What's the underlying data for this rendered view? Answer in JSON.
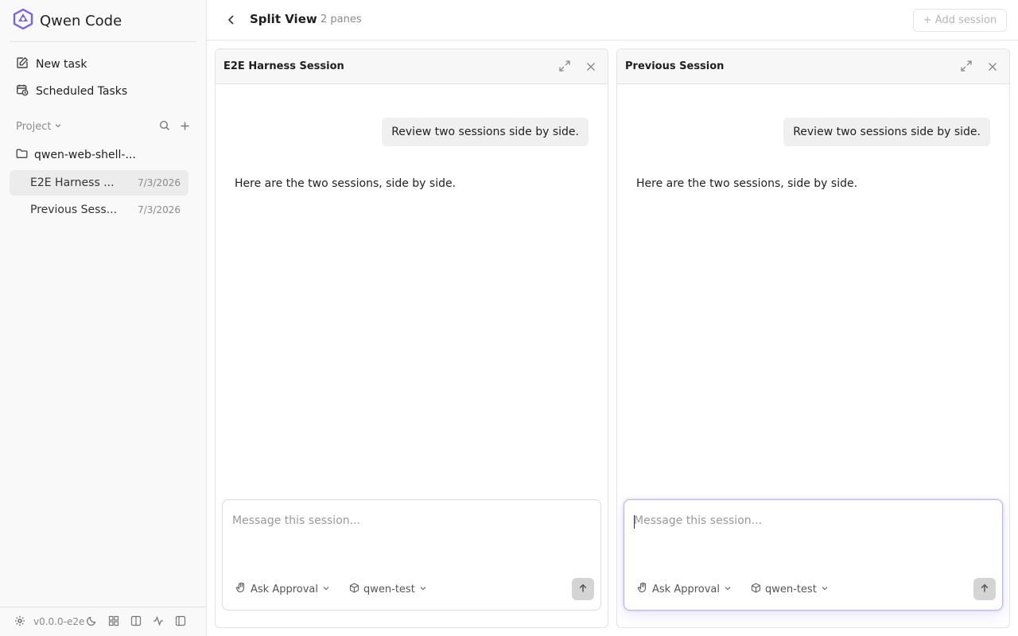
{
  "app": {
    "title": "Qwen Code"
  },
  "sidebar": {
    "new_task": "New task",
    "scheduled_tasks": "Scheduled Tasks",
    "project_label": "Project",
    "folder": "qwen-web-shell-...",
    "sessions": [
      {
        "name": "E2E Harness ...",
        "date": "7/3/2026",
        "active": true
      },
      {
        "name": "Previous Sess...",
        "date": "7/3/2026",
        "active": false
      }
    ],
    "version": "v0.0.0-e2e"
  },
  "topbar": {
    "title": "Split View",
    "pane_count": "2 panes",
    "add_session": "+ Add session"
  },
  "panes": [
    {
      "title": "E2E Harness Session",
      "user_message": "Review two sessions side by side.",
      "assistant_message": "Here are the two sessions, side by side.",
      "placeholder": "Message this session...",
      "approval": "Ask Approval",
      "model": "qwen-test"
    },
    {
      "title": "Previous Session",
      "user_message": "Review two sessions side by side.",
      "assistant_message": "Here are the two sessions, side by side.",
      "placeholder": "Message this session...",
      "approval": "Ask Approval",
      "model": "qwen-test"
    }
  ],
  "colors": {
    "accent": "#7b61e8",
    "border": "#e3e3e3",
    "muted": "#8a8a8a"
  }
}
